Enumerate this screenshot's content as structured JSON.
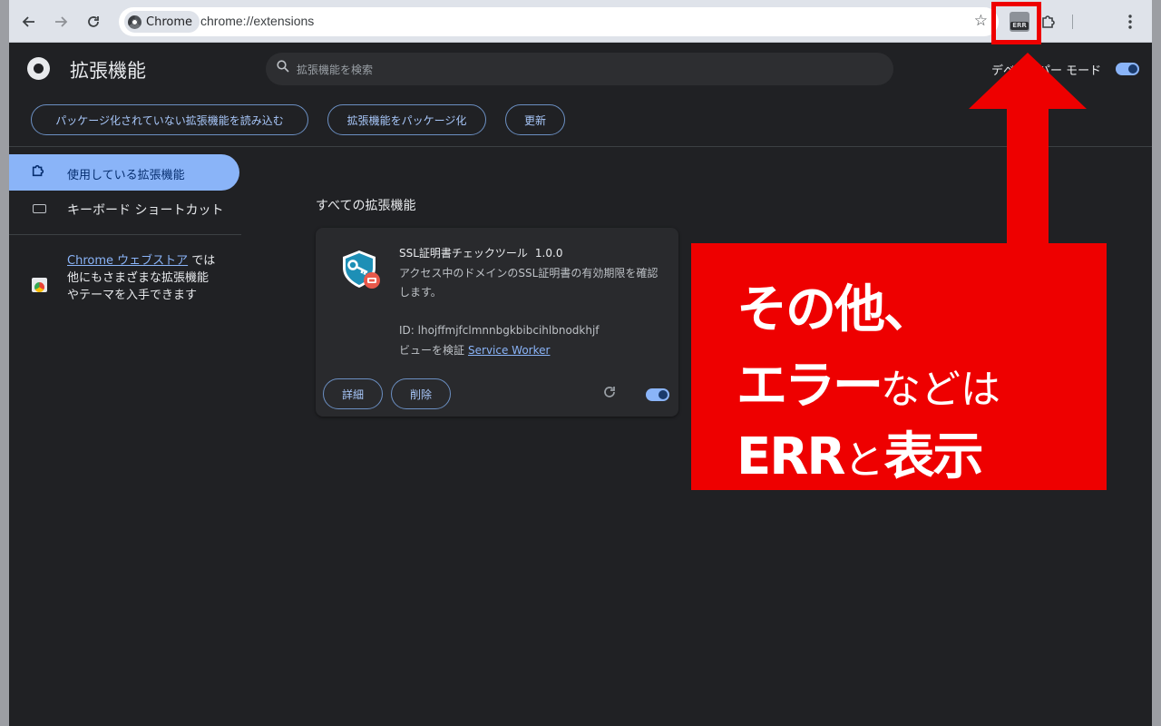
{
  "browser": {
    "chip_label": "Chrome",
    "url": "chrome://extensions",
    "err_badge": "ERR"
  },
  "header": {
    "title": "拡張機能",
    "search_placeholder": "拡張機能を検索",
    "dev_mode_label": "デベロッパー モード",
    "dev_mode_on": true
  },
  "actions": {
    "load_unpacked": "パッケージ化されていない拡張機能を読み込む",
    "pack": "拡張機能をパッケージ化",
    "update": "更新"
  },
  "sidebar": {
    "items": [
      {
        "label": "使用している拡張機能",
        "active": true
      },
      {
        "label": "キーボード ショートカット",
        "active": false
      }
    ],
    "store_link": "Chrome ウェブストア",
    "store_text": " では他にもさまざまな拡張機能やテーマを入手できます"
  },
  "main": {
    "section_title": "すべての拡張機能",
    "extension": {
      "name": "SSL証明書チェックツール",
      "version": "1.0.0",
      "description": "アクセス中のドメインのSSL証明書の有効期限を確認します。",
      "id_text": "ID: lhojffmjfclmnnbgkbibcihlbnodkhjf",
      "inspect_label": "ビューを検証",
      "service_worker": "Service Worker",
      "details_button": "詳細",
      "remove_button": "削除",
      "enabled": true
    }
  },
  "callout": {
    "line1": "その他、",
    "line2_big": "エラー",
    "line2_small": "などは",
    "line3_big_a": "ERR",
    "line3_small": "と",
    "line3_big_b": "表示",
    "color": "#ee0000"
  }
}
